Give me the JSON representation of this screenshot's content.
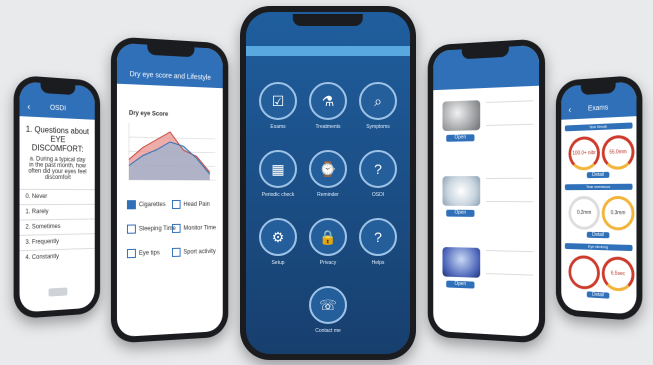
{
  "phone1": {
    "title": "OSDI",
    "question": "1. Questions about EYE DISCOMFORT:",
    "subquestion": "a. During a typical day in the past month, how often did your eyes feel discomfort",
    "options": [
      "0. Never",
      "1. Rarely",
      "2. Sometimes",
      "3. Frequently",
      "4. Constantly"
    ]
  },
  "phone2": {
    "title": "Dry eye score and Lifestyle",
    "chart_title": "Dry eye Score",
    "checks": [
      {
        "label": "Cigarettes",
        "on": true
      },
      {
        "label": "Head Pain",
        "on": false
      },
      {
        "label": "Sleeping Time",
        "on": false
      },
      {
        "label": "Monitor Time",
        "on": false
      },
      {
        "label": "Eye tips",
        "on": false
      },
      {
        "label": "Sport activity",
        "on": false
      }
    ]
  },
  "phone3": {
    "menu": [
      {
        "label": "Exams",
        "icon": "clipboard-icon",
        "glyph": "☑"
      },
      {
        "label": "Treatments",
        "icon": "bottle-icon",
        "glyph": "⚗"
      },
      {
        "label": "Symptoms",
        "icon": "person-search-icon",
        "glyph": "⌕"
      },
      {
        "label": "Periodic check",
        "icon": "calendar-icon",
        "glyph": "▦"
      },
      {
        "label": "Reminder",
        "icon": "watch-icon",
        "glyph": "⌚"
      },
      {
        "label": "OSDI",
        "icon": "person-question-icon",
        "glyph": "?"
      },
      {
        "label": "Setup",
        "icon": "gear-icon",
        "glyph": "⚙"
      },
      {
        "label": "Privacy",
        "icon": "lock-icon",
        "glyph": "🔒"
      },
      {
        "label": "Helps",
        "icon": "help-icon",
        "glyph": "?"
      },
      {
        "label": "Contact me",
        "icon": "phone-icon",
        "glyph": "☏"
      }
    ]
  },
  "phone4": {
    "open_label": "Open"
  },
  "phone5": {
    "title": "Exams",
    "sections": [
      {
        "label": "Tear Break",
        "g1": "100.0+ nibr",
        "g2": "55.0mm",
        "btn": "Detail"
      },
      {
        "label": "Tear meniscus",
        "g1": "0.2mm",
        "g2": "0.3mm",
        "btn": "Detail"
      },
      {
        "label": "Eye blinking",
        "g1": "",
        "g2": "6.5sec",
        "btn": "Detail"
      }
    ]
  },
  "colors": {
    "brand": "#2f70b8",
    "dark": "#173f6e"
  }
}
